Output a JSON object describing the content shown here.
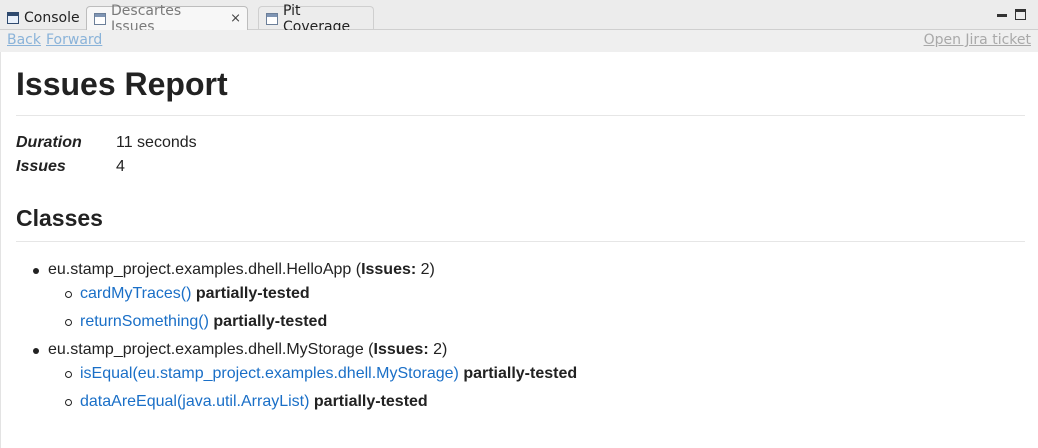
{
  "tabs": [
    {
      "label": "Console"
    },
    {
      "label": "Descartes Issues"
    },
    {
      "label": "Pit Coverage"
    }
  ],
  "nav": {
    "back": "Back",
    "forward": "Forward",
    "jira": "Open Jira ticket"
  },
  "report": {
    "title": "Issues Report",
    "duration_label": "Duration",
    "duration_value": "11 seconds",
    "issues_label": "Issues",
    "issues_value": "4",
    "classes_heading": "Classes"
  },
  "classes": [
    {
      "name": "eu.stamp_project.examples.dhell.HelloApp",
      "open": "(",
      "issues_label": "Issues:",
      "issues_count": "2)",
      "methods": [
        {
          "signature": "cardMyTraces()",
          "status": "partially-tested"
        },
        {
          "signature": "returnSomething()",
          "status": "partially-tested"
        }
      ]
    },
    {
      "name": "eu.stamp_project.examples.dhell.MyStorage",
      "open": "(",
      "issues_label": "Issues:",
      "issues_count": "2)",
      "methods": [
        {
          "signature": "isEqual(eu.stamp_project.examples.dhell.MyStorage)",
          "status": "partially-tested"
        },
        {
          "signature": "dataAreEqual(java.util.ArrayList)",
          "status": "partially-tested"
        }
      ]
    }
  ],
  "icons": {
    "console": "console-icon",
    "view": "view-icon",
    "close": "close-icon",
    "minimize": "minimize-icon",
    "maximize": "maximize-icon"
  },
  "colors": {
    "link": "#1a6fc7",
    "nav_link": "#8ab3d9",
    "disabled_link": "#a9a9a9"
  }
}
